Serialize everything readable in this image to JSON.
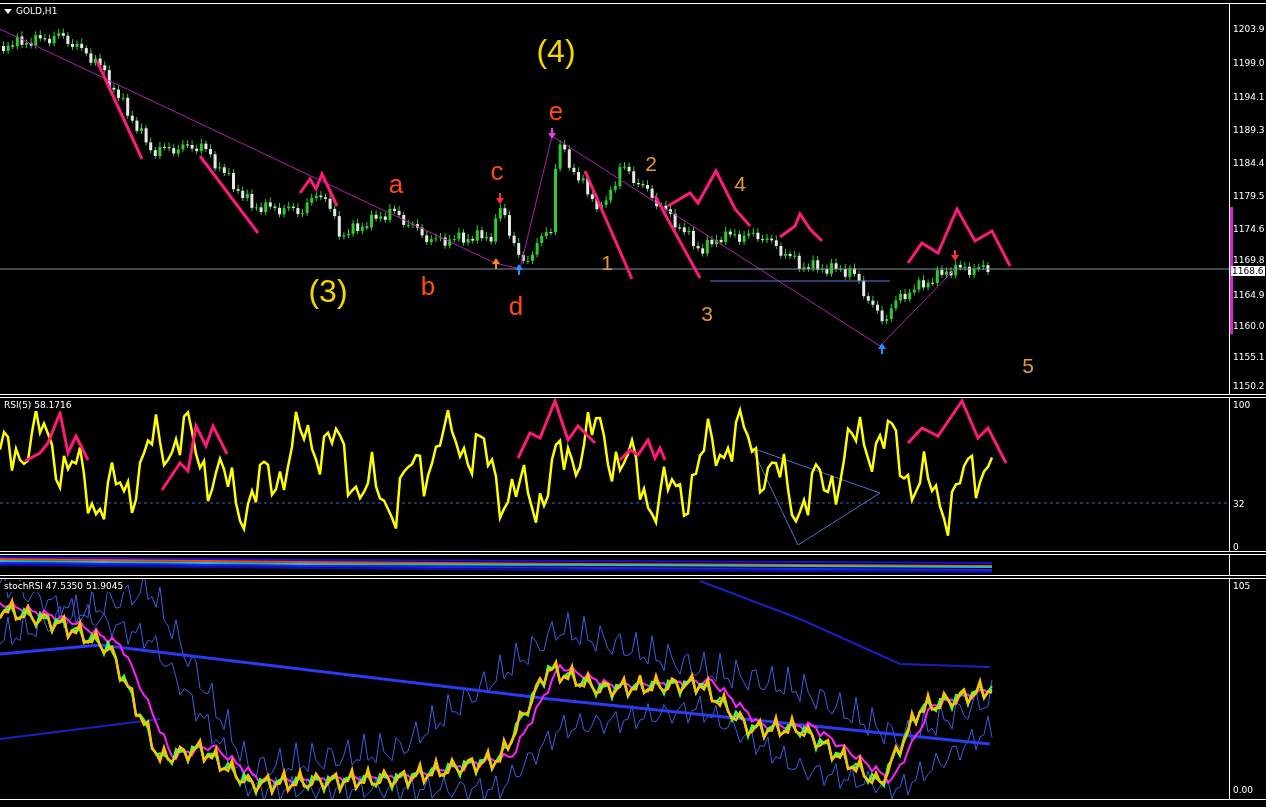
{
  "main_panel": {
    "title": "GOLD,H1",
    "axis_labels": [
      "1203.9",
      "1199.0",
      "1194.1",
      "1189.3",
      "1184.4",
      "1179.5",
      "1174.6",
      "1169.8",
      "1164.9",
      "1160.0",
      "1155.1",
      "1150.2"
    ],
    "current_price": "1168.6",
    "wave_labels": [
      {
        "text": "(3)",
        "kind": "major",
        "color": "#f2d600"
      },
      {
        "text": "a",
        "kind": "medium",
        "color": "#ff4a10"
      },
      {
        "text": "b",
        "kind": "medium",
        "color": "#ff4a10"
      },
      {
        "text": "c",
        "kind": "medium",
        "color": "#ff4a10"
      },
      {
        "text": "d",
        "kind": "medium",
        "color": "#ff4a10"
      },
      {
        "text": "(4)",
        "kind": "major",
        "color": "#f2d600"
      },
      {
        "text": "e",
        "kind": "medium",
        "color": "#ff4a10"
      },
      {
        "text": "1",
        "kind": "minor",
        "color": "#e09a30"
      },
      {
        "text": "2",
        "kind": "minor",
        "color": "#e09a30"
      },
      {
        "text": "3",
        "kind": "minor",
        "color": "#e09a30"
      },
      {
        "text": "4",
        "kind": "minor",
        "color": "#e09a30"
      },
      {
        "text": "5",
        "kind": "minor",
        "color": "#e09a30"
      }
    ]
  },
  "rsi_panel": {
    "title": "RSI(5) 58.1716",
    "axis_labels": [
      "100",
      "32",
      "0"
    ]
  },
  "stoch_panel": {
    "title": "stochRSI 47.5350 51.9045",
    "axis_labels": [
      "105",
      "0.00"
    ]
  }
}
